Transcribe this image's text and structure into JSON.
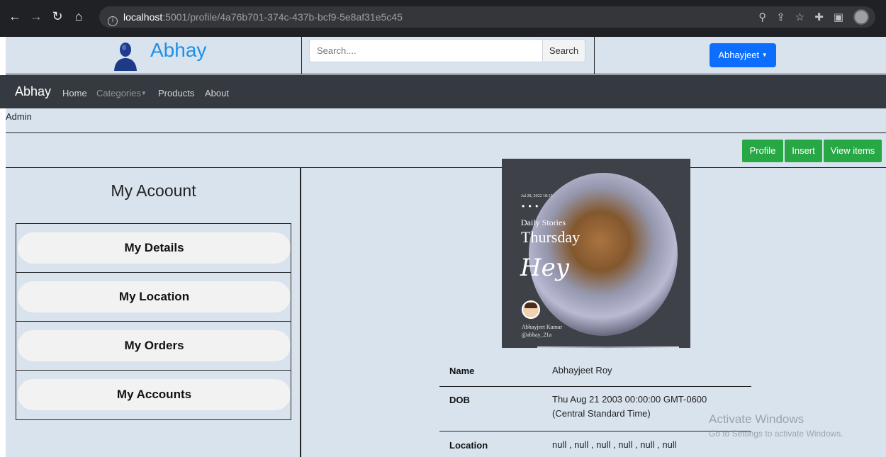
{
  "browser": {
    "url_host": "localhost",
    "url_path": ":5001/profile/4a76b701-374c-437b-bcf9-5e8af31e5c45"
  },
  "header": {
    "brand": "Abhay",
    "search_placeholder": "Search....",
    "search_button": "Search",
    "user_menu": "Abhayjeet"
  },
  "navbar": {
    "brand": "Abhay",
    "links": [
      "Home",
      "Categories",
      "Products",
      "About"
    ]
  },
  "role": "Admin",
  "toolbar": {
    "buttons": [
      "Profile",
      "Insert",
      "View items"
    ]
  },
  "sidebar": {
    "title": "My Acoount",
    "items": [
      "My Details",
      "My Location",
      "My Orders",
      "My Accounts"
    ]
  },
  "profile_image": {
    "date": "Jul 28, 2022 18:15",
    "dots": "• • •",
    "kicker": "Daily Stories",
    "day": "Thursday",
    "greeting": "Hey",
    "name": "Abhayjeet Kumar",
    "handle": "@abhay_21a"
  },
  "details": [
    {
      "label": "Name",
      "value": "Abhayjeet Roy"
    },
    {
      "label": "DOB",
      "value": "Thu Aug 21 2003 00:00:00 GMT-0600 (Central Standard Time)"
    },
    {
      "label": "Location",
      "value": "null , null , null , null , null , null"
    }
  ],
  "watermark": {
    "line1": "Activate Windows",
    "line2": "Go to Settings to activate Windows."
  },
  "colors": {
    "brand_blue": "#1e90e8",
    "navbar_bg": "#343a40",
    "page_bg": "#d9e3ee",
    "green_button": "#28a745",
    "primary_button": "#0d6efd"
  }
}
